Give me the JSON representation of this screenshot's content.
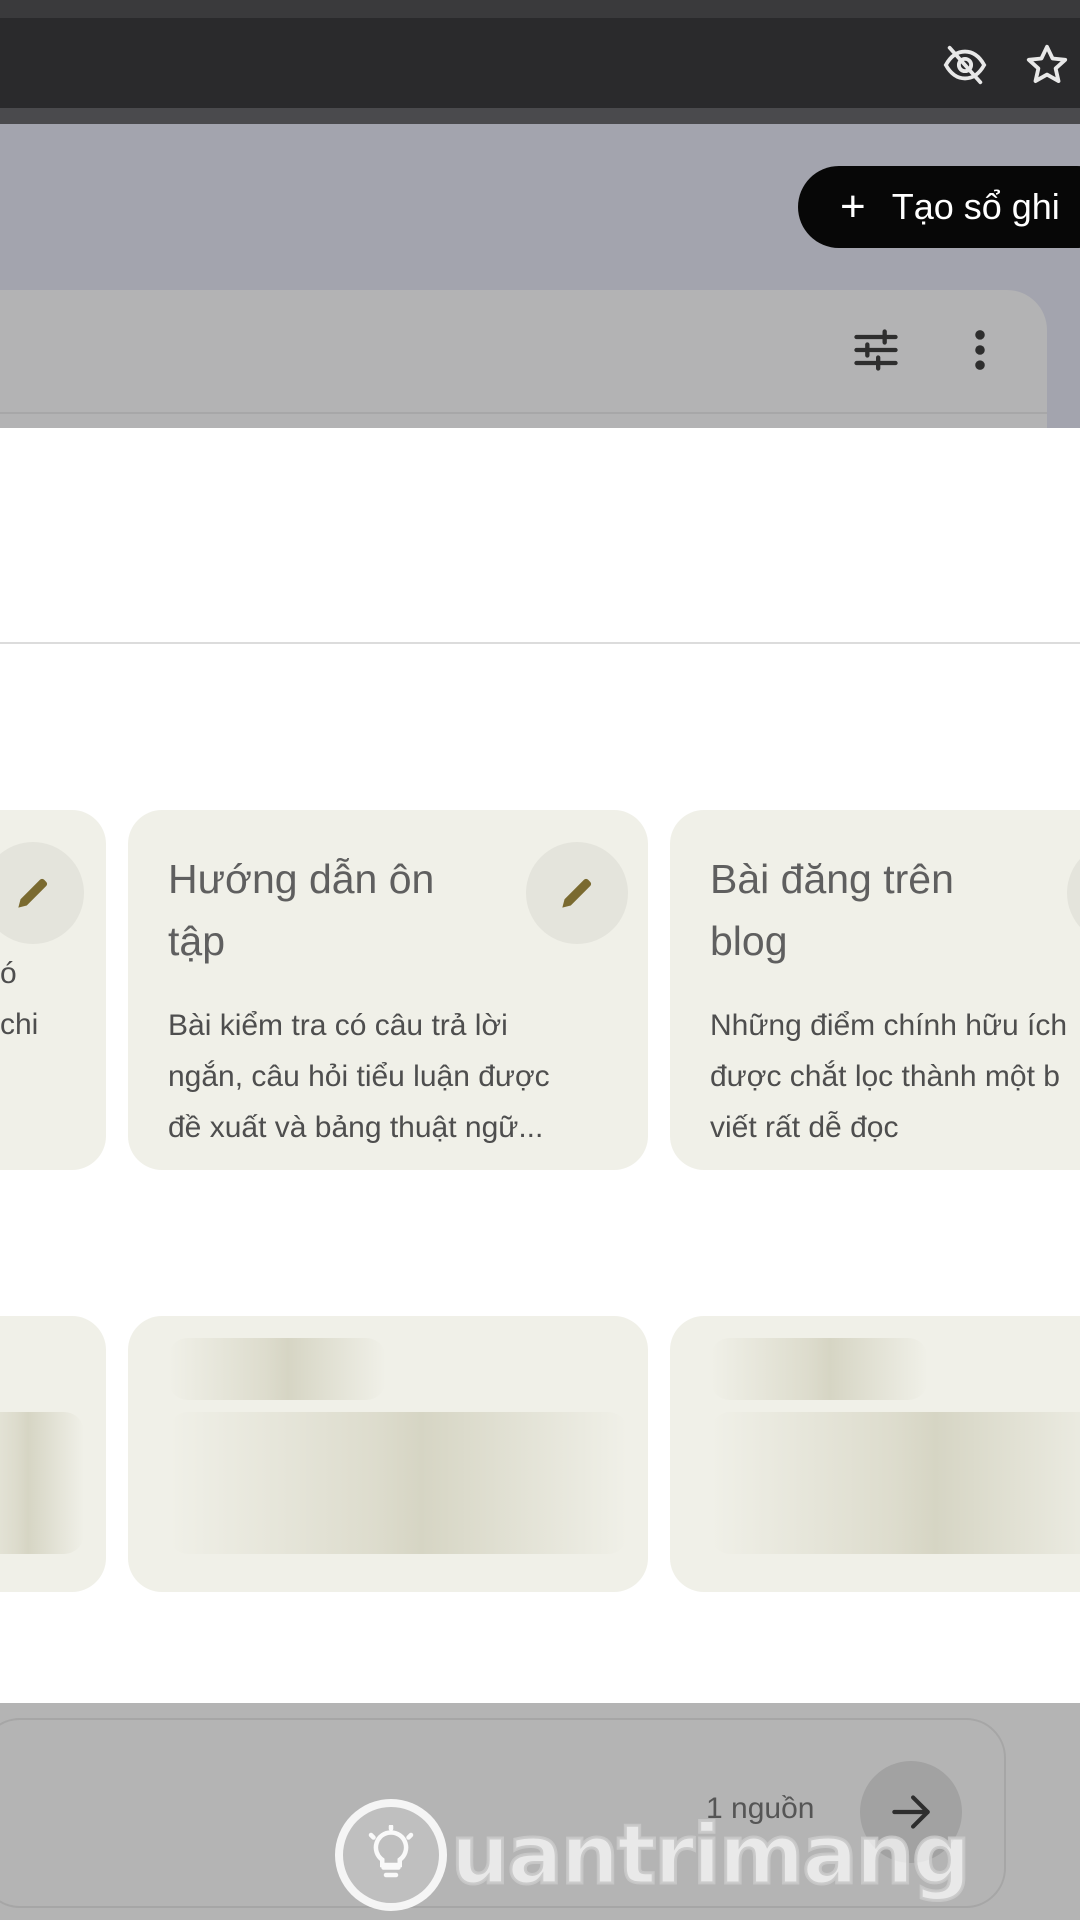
{
  "header": {
    "create_button_label": "Tạo sổ ghi",
    "create_button_icon": "plus-icon"
  },
  "browser": {
    "icons": [
      "eye-off-icon",
      "star-icon"
    ]
  },
  "toolbar": {
    "icons": [
      "tune-icon",
      "more-vert-icon"
    ]
  },
  "cards": [
    {
      "title_lines": [
        "Hướng dẫn ôn",
        "tập"
      ],
      "desc_lines": [
        "Bài kiểm tra có câu trả lời",
        "ngắn, câu hỏi tiểu luận được",
        "đề xuất và bảng thuật ngữ..."
      ],
      "icon": "pencil-icon"
    },
    {
      "title_lines": [
        "Bài đăng trên",
        "blog"
      ],
      "desc_lines": [
        "Những điểm chính hữu ích",
        "được chắt lọc thành một b",
        "viết rất dễ đọc"
      ],
      "icon": "pencil-icon"
    }
  ],
  "partial_card": {
    "desc_lines": [
      "ó",
      "chi"
    ]
  },
  "chat": {
    "source_count": "1 nguồn",
    "send_icon": "arrow-right-icon"
  },
  "watermark": {
    "text": "uantrimang"
  },
  "colors": {
    "card_bg": "#f0f0e8",
    "icon_olive": "#7a6a30",
    "dim_overlay": "#a3a4ae"
  }
}
